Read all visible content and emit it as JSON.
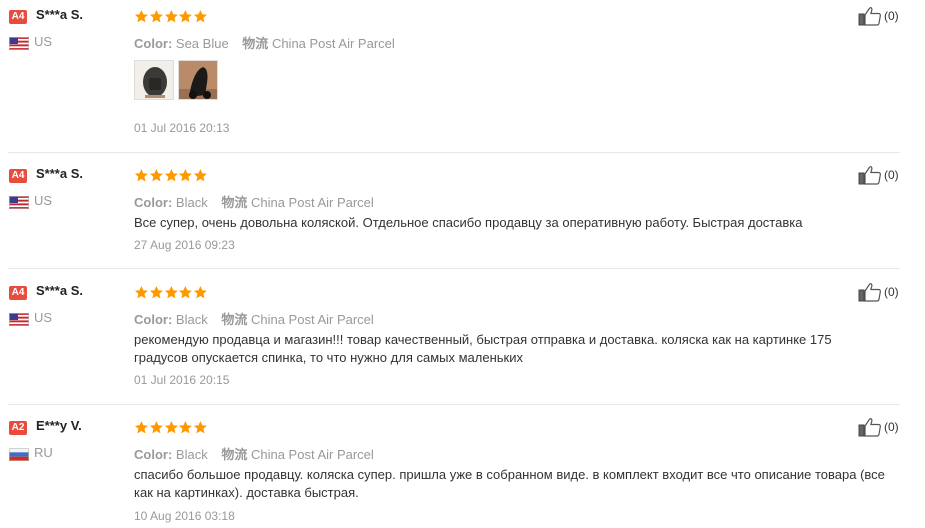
{
  "reviews": [
    {
      "level": "A4",
      "level_color": "#e84c3d",
      "name": "S***a S.",
      "country": "US",
      "flag": "us-flag",
      "rating": 5,
      "color_label": "Color:",
      "color_value": "Sea Blue",
      "shipping_label": "物流",
      "shipping_value": "China Post Air Parcel",
      "text": "",
      "date": "01 Jul 2016 20:13",
      "likes": "(0)",
      "has_photos": true
    },
    {
      "level": "A4",
      "level_color": "#e84c3d",
      "name": "S***a S.",
      "country": "US",
      "flag": "us-flag",
      "rating": 5,
      "color_label": "Color:",
      "color_value": "Black",
      "shipping_label": "物流",
      "shipping_value": "China Post Air Parcel",
      "text": "Все супер, очень довольна коляской. Отдельное спасибо продавцу за оперативную работу. Быстрая доставка",
      "date": "27 Aug 2016 09:23",
      "likes": "(0)"
    },
    {
      "level": "A4",
      "level_color": "#e84c3d",
      "name": "S***a S.",
      "country": "US",
      "flag": "us-flag",
      "rating": 5,
      "color_label": "Color:",
      "color_value": "Black",
      "shipping_label": "物流",
      "shipping_value": "China Post Air Parcel",
      "text": "рекомендую продавца и магазин!!! товар качественный, быстрая отправка и доставка. коляска как на картинке 175 градусов опускается спинка, то что нужно для самых маленьких",
      "date": "01 Jul 2016 20:15",
      "likes": "(0)"
    },
    {
      "level": "A2",
      "level_color": "#e84c3d",
      "name": "E***y V.",
      "country": "RU",
      "flag": "ru-flag",
      "rating": 5,
      "color_label": "Color:",
      "color_value": "Black",
      "shipping_label": "物流",
      "shipping_value": "China Post Air Parcel",
      "text": "спасибо большое продавцу. коляска супер. пришла уже в собранном виде. в комплект входит все что описание товара (все как на картинках). доставка быстрая.",
      "date": "10 Aug 2016 03:18",
      "likes": "(0)"
    }
  ],
  "colors": {
    "star": "#ff9900",
    "muted_text": "#999999",
    "body_text": "#333333"
  }
}
